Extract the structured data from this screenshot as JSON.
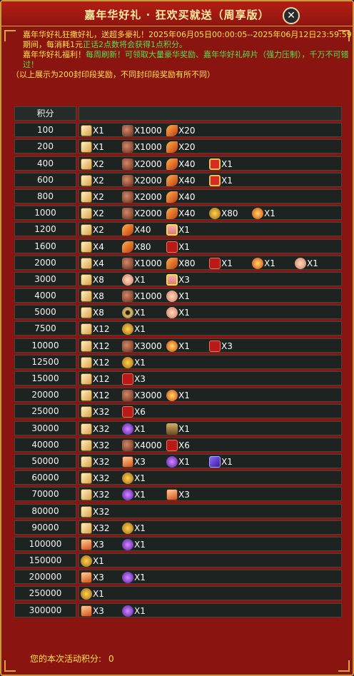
{
  "window": {
    "title": "嘉年华好礼 · 狂欢买就送（周享版）",
    "close_icon": "close-icon",
    "colors": {
      "frame": "#8a1410",
      "border": "#c89a3a",
      "row_bg": "#1d2320",
      "highlight": "#ffe34a",
      "green": "#55e14a"
    }
  },
  "info": {
    "line1_a": "嘉年华好礼狂撒好礼，送超多豪礼！",
    "line1_b": "2025年06月05日00:00:05--2025年06月12日23:59:59期间，每消耗1元",
    "line1_c": "正话2点数将会获得1点积分。",
    "line2_a": "嘉年华好礼福利！",
    "line2_b": "每周刷新！可领取大量豪华奖励、嘉年华好礼碎片（强力压制），千万不可错过！",
    "line3": "（以上展示为200封印段奖励，不同封印段奖励有所不同）"
  },
  "table": {
    "header": "积分",
    "rows": [
      {
        "points": "100",
        "items": [
          {
            "icon": "scroll",
            "qty": "X1"
          },
          {
            "icon": "ore",
            "qty": "X1000"
          },
          {
            "icon": "feather",
            "qty": "X20"
          }
        ]
      },
      {
        "points": "200",
        "items": [
          {
            "icon": "scroll",
            "qty": "X1"
          },
          {
            "icon": "ore",
            "qty": "X1000"
          },
          {
            "icon": "feather",
            "qty": "X20"
          }
        ]
      },
      {
        "points": "400",
        "items": [
          {
            "icon": "scroll",
            "qty": "X2"
          },
          {
            "icon": "ore",
            "qty": "X2000"
          },
          {
            "icon": "feather",
            "qty": "X40"
          },
          {
            "icon": "gift",
            "qty": "X1"
          }
        ]
      },
      {
        "points": "600",
        "items": [
          {
            "icon": "scroll",
            "qty": "X2"
          },
          {
            "icon": "ore",
            "qty": "X2000"
          },
          {
            "icon": "feather",
            "qty": "X40"
          },
          {
            "icon": "gift",
            "qty": "X1"
          }
        ]
      },
      {
        "points": "800",
        "items": [
          {
            "icon": "scroll",
            "qty": "X2"
          },
          {
            "icon": "ore",
            "qty": "X2000"
          },
          {
            "icon": "feather",
            "qty": "X40"
          }
        ]
      },
      {
        "points": "1000",
        "items": [
          {
            "icon": "scroll",
            "qty": "X2"
          },
          {
            "icon": "ore",
            "qty": "X2000"
          },
          {
            "icon": "feather",
            "qty": "X40"
          },
          {
            "icon": "coin",
            "qty": "X80"
          },
          {
            "icon": "flame",
            "qty": "X1"
          }
        ]
      },
      {
        "points": "1200",
        "items": [
          {
            "icon": "scroll",
            "qty": "X2"
          },
          {
            "icon": "feather",
            "qty": "X40"
          },
          {
            "icon": "giftbox",
            "qty": "X1"
          }
        ]
      },
      {
        "points": "1600",
        "items": [
          {
            "icon": "scroll",
            "qty": "X4"
          },
          {
            "icon": "feather",
            "qty": "X80"
          },
          {
            "icon": "redbox",
            "qty": "X1"
          }
        ]
      },
      {
        "points": "2000",
        "items": [
          {
            "icon": "scroll",
            "qty": "X4"
          },
          {
            "icon": "ore",
            "qty": "X1000"
          },
          {
            "icon": "feather",
            "qty": "X80"
          },
          {
            "icon": "redbox",
            "qty": "X1"
          },
          {
            "icon": "flame",
            "qty": "X1"
          },
          {
            "icon": "flower",
            "qty": "X1"
          }
        ]
      },
      {
        "points": "3000",
        "items": [
          {
            "icon": "scroll",
            "qty": "X8"
          },
          {
            "icon": "flower",
            "qty": "X1"
          },
          {
            "icon": "giftbox",
            "qty": "X3"
          }
        ]
      },
      {
        "points": "4000",
        "items": [
          {
            "icon": "scroll",
            "qty": "X8"
          },
          {
            "icon": "ore",
            "qty": "X1000"
          },
          {
            "icon": "flower",
            "qty": "X1"
          }
        ]
      },
      {
        "points": "5000",
        "items": [
          {
            "icon": "scroll",
            "qty": "X8"
          },
          {
            "icon": "eye",
            "qty": "X1"
          },
          {
            "icon": "flower",
            "qty": "X1"
          }
        ]
      },
      {
        "points": "7500",
        "items": [
          {
            "icon": "scroll",
            "qty": "X12"
          },
          {
            "icon": "coin",
            "qty": "X1"
          }
        ]
      },
      {
        "points": "10000",
        "items": [
          {
            "icon": "scroll",
            "qty": "X12"
          },
          {
            "icon": "ore",
            "qty": "X3000"
          },
          {
            "icon": "flame",
            "qty": "X1"
          },
          {
            "icon": "redbox",
            "qty": "X3"
          }
        ]
      },
      {
        "points": "12500",
        "items": [
          {
            "icon": "scroll",
            "qty": "X12"
          },
          {
            "icon": "coin",
            "qty": "X1"
          }
        ]
      },
      {
        "points": "15000",
        "items": [
          {
            "icon": "scroll",
            "qty": "X12"
          },
          {
            "icon": "redbox",
            "qty": "X3"
          }
        ]
      },
      {
        "points": "20000",
        "items": [
          {
            "icon": "scroll",
            "qty": "X12"
          },
          {
            "icon": "ore",
            "qty": "X3000"
          },
          {
            "icon": "flame",
            "qty": "X1"
          }
        ]
      },
      {
        "points": "25000",
        "items": [
          {
            "icon": "scroll",
            "qty": "X32"
          },
          {
            "icon": "redbox",
            "qty": "X6"
          }
        ]
      },
      {
        "points": "30000",
        "items": [
          {
            "icon": "scroll",
            "qty": "X32"
          },
          {
            "icon": "purple",
            "qty": "X1"
          },
          {
            "icon": "warrior",
            "qty": "X1"
          }
        ]
      },
      {
        "points": "40000",
        "items": [
          {
            "icon": "scroll",
            "qty": "X32"
          },
          {
            "icon": "ore",
            "qty": "X4000"
          },
          {
            "icon": "redbox",
            "qty": "X6"
          }
        ]
      },
      {
        "points": "50000",
        "items": [
          {
            "icon": "scroll",
            "qty": "X32"
          },
          {
            "icon": "card",
            "qty": "X3"
          },
          {
            "icon": "purple",
            "qty": "X1"
          },
          {
            "icon": "pbook",
            "qty": "X1"
          }
        ]
      },
      {
        "points": "60000",
        "items": [
          {
            "icon": "scroll",
            "qty": "X32"
          },
          {
            "icon": "coin",
            "qty": "X1"
          }
        ]
      },
      {
        "points": "70000",
        "items": [
          {
            "icon": "scroll",
            "qty": "X32"
          },
          {
            "icon": "purple",
            "qty": "X1"
          },
          {
            "icon": "card",
            "qty": "X3"
          }
        ]
      },
      {
        "points": "80000",
        "items": [
          {
            "icon": "scroll",
            "qty": "X32"
          }
        ]
      },
      {
        "points": "90000",
        "items": [
          {
            "icon": "scroll",
            "qty": "X32"
          },
          {
            "icon": "coin",
            "qty": "X1"
          }
        ]
      },
      {
        "points": "100000",
        "items": [
          {
            "icon": "card",
            "qty": "X3"
          },
          {
            "icon": "purple",
            "qty": "X1"
          }
        ]
      },
      {
        "points": "150000",
        "items": [
          {
            "icon": "coin",
            "qty": "X1"
          }
        ]
      },
      {
        "points": "200000",
        "items": [
          {
            "icon": "card",
            "qty": "X3"
          },
          {
            "icon": "purple",
            "qty": "X1"
          }
        ]
      },
      {
        "points": "250000",
        "items": [
          {
            "icon": "coin",
            "qty": "X1"
          }
        ]
      },
      {
        "points": "300000",
        "items": [
          {
            "icon": "card",
            "qty": "X3"
          },
          {
            "icon": "purple",
            "qty": "X1"
          }
        ]
      }
    ]
  },
  "footer": {
    "label": "您的本次活动积分:",
    "value": "0"
  }
}
